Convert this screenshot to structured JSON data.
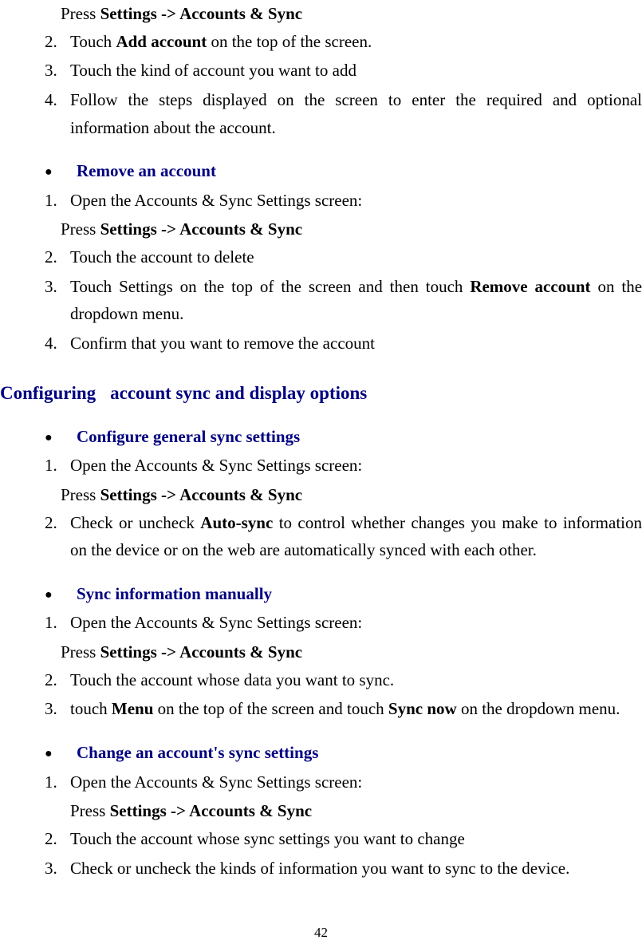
{
  "sec_add": {
    "press_prefix": "Press ",
    "press_bold": "Settings -> Accounts & Sync",
    "items": [
      {
        "n": "2.",
        "segs": [
          "Touch ",
          {
            "b": true,
            "t": "Add account"
          },
          " on the top of the screen."
        ]
      },
      {
        "n": "3.",
        "segs": [
          "Touch the kind of account you want to add"
        ]
      },
      {
        "n": "4.",
        "justify": true,
        "segs": [
          "Follow the steps displayed on the screen to enter the required and optional information about the account."
        ]
      }
    ]
  },
  "sec_remove": {
    "title": "Remove an account",
    "items": [
      {
        "n": "1.",
        "segs": [
          "Open the Accounts & Sync Settings screen:"
        ],
        "press": {
          "prefix": "Press ",
          "bold": "Settings -> Accounts & Sync"
        }
      },
      {
        "n": "2.",
        "segs": [
          "Touch the account to delete"
        ]
      },
      {
        "n": "3.",
        "justify": true,
        "segs": [
          "Touch Settings on the top of the screen and then touch ",
          {
            "b": true,
            "t": "Remove account"
          },
          " on the dropdown menu."
        ]
      },
      {
        "n": "4.",
        "segs": [
          "Confirm that you want to remove the account"
        ]
      }
    ]
  },
  "heading": {
    "p1": "Configuring",
    "p2": "account sync and display options"
  },
  "sec_general": {
    "title": "Configure general sync settings",
    "items": [
      {
        "n": "1.",
        "segs": [
          "Open the Accounts & Sync Settings screen:"
        ],
        "press": {
          "prefix": "Press ",
          "bold": "Settings -> Accounts & Sync"
        }
      },
      {
        "n": "2.",
        "justify": true,
        "segs": [
          "Check or uncheck ",
          {
            "b": true,
            "t": "Auto-sync"
          },
          " to control whether changes you make to information on the device or on the web are automatically synced with each other."
        ]
      }
    ]
  },
  "sec_manual": {
    "title": "Sync information manually",
    "items": [
      {
        "n": "1.",
        "segs": [
          "Open the Accounts & Sync Settings screen:"
        ],
        "press": {
          "prefix": "Press ",
          "bold": "Settings -> Accounts & Sync"
        }
      },
      {
        "n": "2.",
        "segs": [
          "Touch the account whose data you want to sync."
        ]
      },
      {
        "n": "3.",
        "segs": [
          "touch ",
          {
            "b": true,
            "t": "Menu"
          },
          " on the top of the screen and touch ",
          {
            "b": true,
            "t": "Sync now"
          },
          " on the dropdown menu."
        ]
      }
    ]
  },
  "sec_change": {
    "title": "Change an account's sync settings",
    "items": [
      {
        "n": "1.",
        "segs": [
          "Open the Accounts & Sync Settings screen:"
        ],
        "press_inner": {
          "prefix": "Press ",
          "bold": "Settings -> Accounts & Sync"
        }
      },
      {
        "n": "2.",
        "segs": [
          "Touch the account whose sync settings you want to change"
        ]
      },
      {
        "n": "3.",
        "segs": [
          "Check or uncheck the kinds of information you want to sync to the device."
        ]
      }
    ]
  },
  "page_number": "42"
}
